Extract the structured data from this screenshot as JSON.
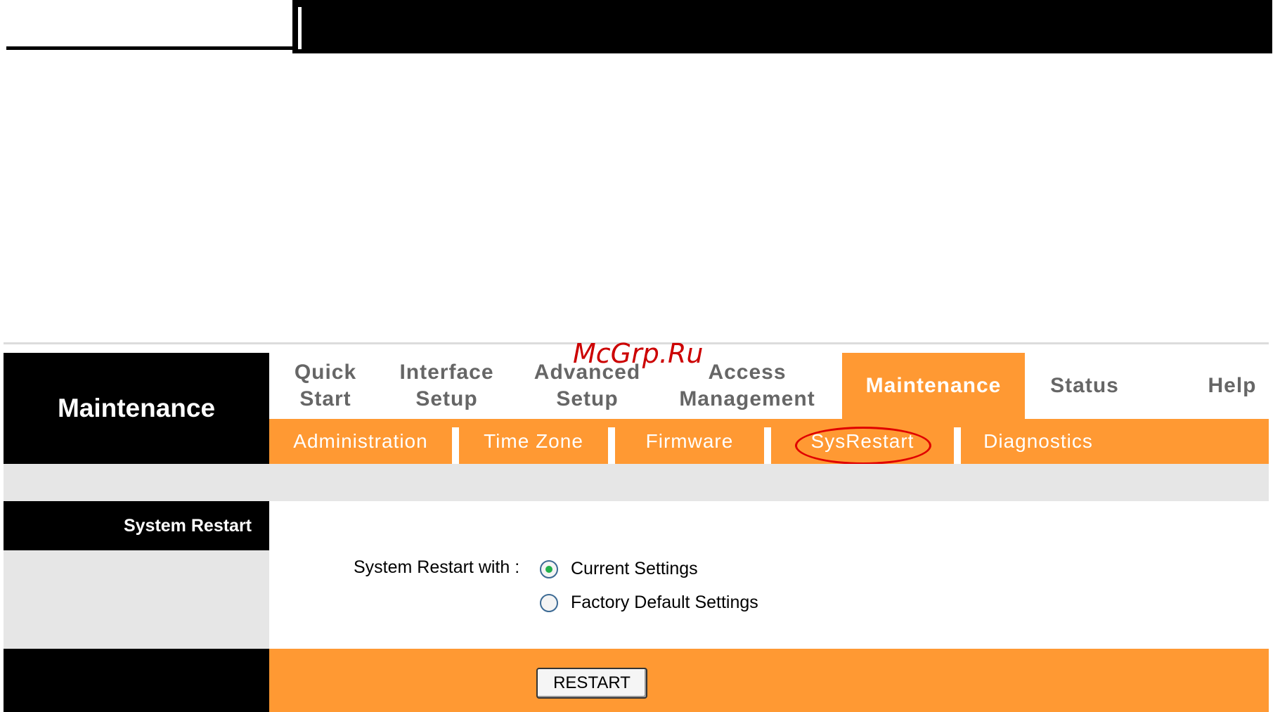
{
  "watermark": "McGrp.Ru",
  "left": {
    "title": "Maintenance",
    "section": "System Restart"
  },
  "mainnav": {
    "items": [
      {
        "label": "Quick\nStart"
      },
      {
        "label": "Interface\nSetup"
      },
      {
        "label": "Advanced\nSetup"
      },
      {
        "label": "Access\nManagement"
      },
      {
        "label": "Maintenance"
      },
      {
        "label": "Status"
      },
      {
        "label": "Help"
      }
    ]
  },
  "subnav": {
    "items": [
      {
        "label": "Administration"
      },
      {
        "label": "Time Zone"
      },
      {
        "label": "Firmware"
      },
      {
        "label": "SysRestart"
      },
      {
        "label": "Diagnostics"
      }
    ]
  },
  "form": {
    "restart_label": "System Restart with :",
    "options": [
      {
        "label": "Current Settings",
        "selected": true
      },
      {
        "label": "Factory Default Settings",
        "selected": false
      }
    ],
    "restart_button": "RESTART"
  },
  "colors": {
    "accent": "#ff9933",
    "highlight_circle": "#e00000"
  }
}
